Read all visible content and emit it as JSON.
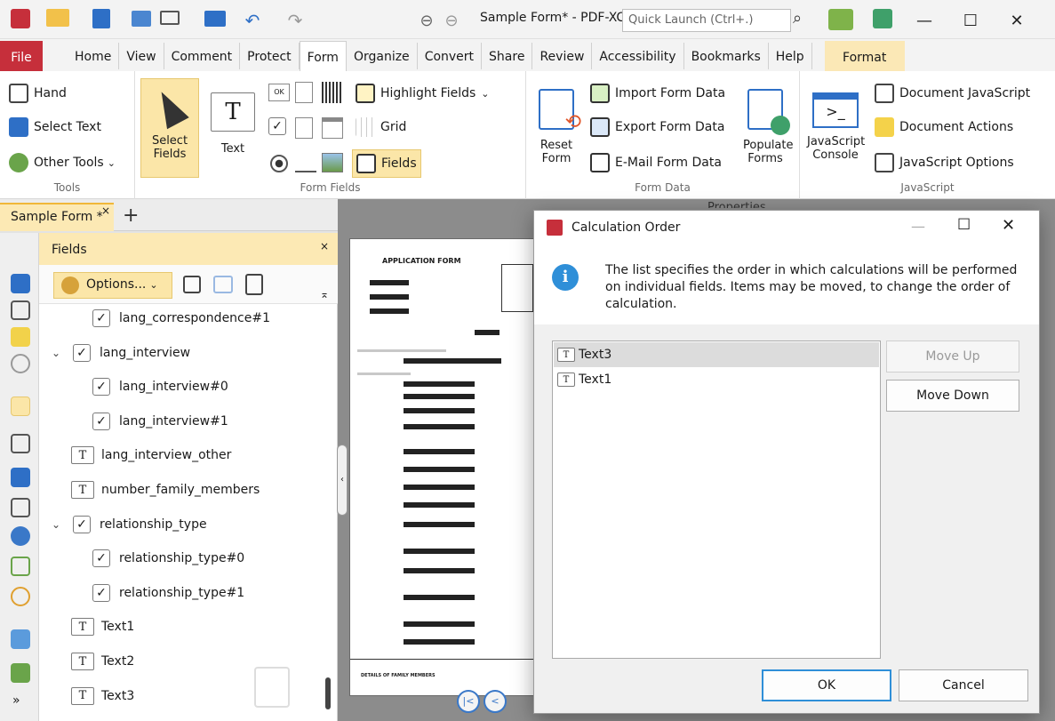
{
  "window": {
    "title": "Sample Form* - PDF-XChange ..",
    "quick_launch_placeholder": "Quick Launch (Ctrl+.)"
  },
  "menu": [
    "File",
    "Home",
    "View",
    "Comment",
    "Protect",
    "Form",
    "Organize",
    "Convert",
    "Share",
    "Review",
    "Accessibility",
    "Bookmarks",
    "Help",
    "Format"
  ],
  "menu_active": "Form",
  "ribbon": {
    "tools": {
      "label": "Tools",
      "hand": "Hand",
      "select_text": "Select Text",
      "other_tools": "Other Tools"
    },
    "form_fields": {
      "label": "Form Fields",
      "select_fields": "Select Fields",
      "text": "Text",
      "highlight_fields": "Highlight Fields",
      "grid": "Grid",
      "fields": "Fields"
    },
    "form_data": {
      "label": "Form Data",
      "reset_form": "Reset Form",
      "import": "Import Form Data",
      "export": "Export Form Data",
      "email": "E-Mail Form Data",
      "populate": "Populate Forms"
    },
    "javascript": {
      "label": "JavaScript",
      "console": "JavaScript Console",
      "document_js": "Document JavaScript",
      "document_actions": "Document Actions",
      "js_options": "JavaScript Options"
    }
  },
  "doc_tab": {
    "label": "Sample Form *",
    "close": "×",
    "new_tab": "+"
  },
  "fields_panel": {
    "title": "Fields",
    "options": "Options...",
    "items": [
      {
        "label": "lang_correspondence#1",
        "type": "checkbox",
        "indent": 1
      },
      {
        "label": "lang_interview",
        "type": "checkbox",
        "indent": 0,
        "expandable": true
      },
      {
        "label": "lang_interview#0",
        "type": "checkbox",
        "indent": 1
      },
      {
        "label": "lang_interview#1",
        "type": "checkbox",
        "indent": 1
      },
      {
        "label": "lang_interview_other",
        "type": "text",
        "indent": 0
      },
      {
        "label": "number_family_members",
        "type": "text",
        "indent": 0
      },
      {
        "label": "relationship_type",
        "type": "checkbox",
        "indent": 0,
        "expandable": true
      },
      {
        "label": "relationship_type#0",
        "type": "checkbox",
        "indent": 1
      },
      {
        "label": "relationship_type#1",
        "type": "checkbox",
        "indent": 1
      },
      {
        "label": "Text1",
        "type": "text",
        "indent": 0
      },
      {
        "label": "Text2",
        "type": "text",
        "indent": 0
      },
      {
        "label": "Text3",
        "type": "text",
        "indent": 0
      }
    ]
  },
  "page_preview": {
    "header": "APPLICATION FORM",
    "footer": "DETAILS OF FAMILY MEMBERS"
  },
  "properties_tab": "Properties",
  "dialog": {
    "title": "Calculation Order",
    "info": "The list specifies the order in which calculations will be performed on individual fields. Items may be moved, to change the order of calculation.",
    "items": [
      "Text3",
      "Text1"
    ],
    "move_up": "Move Up",
    "move_down": "Move Down",
    "ok": "OK",
    "cancel": "Cancel"
  },
  "colors": {
    "accent": "#c62f3b",
    "tab_highlight": "#fce9b4",
    "info_blue": "#2f8fd8"
  }
}
